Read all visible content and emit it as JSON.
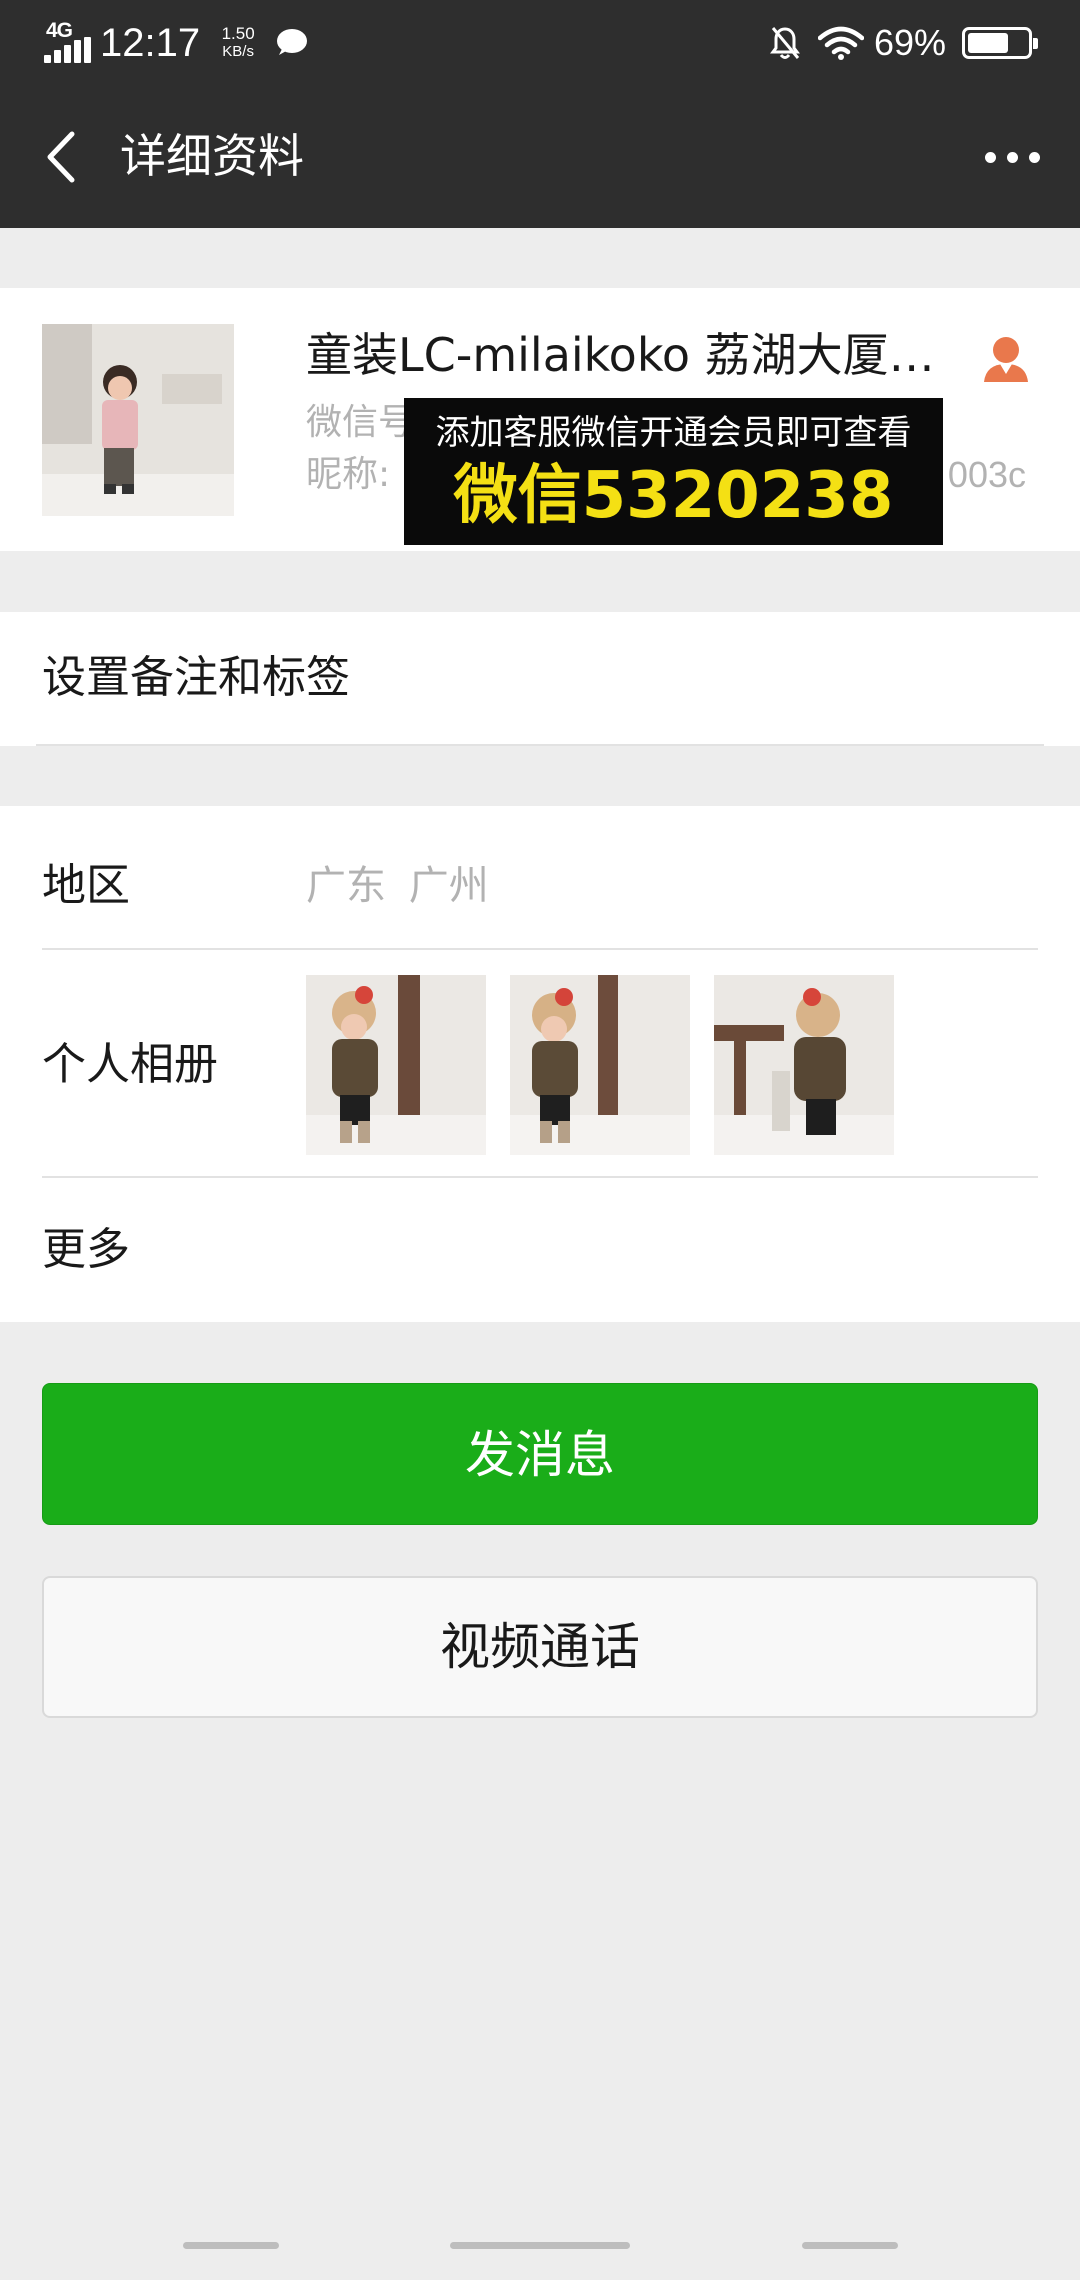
{
  "status_bar": {
    "network": "4G",
    "time": "12:17",
    "speed_value": "1.50",
    "speed_unit": "KB/s",
    "battery_percent": "69%",
    "battery_level": 0.69
  },
  "title_bar": {
    "title": "详细资料"
  },
  "profile": {
    "name": "童装LC-milaikoko 荔湖大厦…",
    "wechat_id_label": "微信号",
    "nickname_label": "昵称:",
    "nickname_tail": "003c",
    "promo_line1": "添加客服微信开通会员即可查看",
    "promo_line2": "微信5320238"
  },
  "remark": {
    "label": "设置备注和标签"
  },
  "info": {
    "region_label": "地区",
    "region_value": "广东  广州",
    "album_label": "个人相册",
    "more_label": "更多"
  },
  "actions": {
    "send_message": "发消息",
    "video_call": "视频通话"
  },
  "colors": {
    "header_bg": "#2e2e2e",
    "primary_green": "#1aad19",
    "page_bg": "#ededed",
    "promo_yellow": "#f4e014",
    "contact_icon": "#e9784c"
  },
  "icons": {
    "back": "chevron-left-icon",
    "more": "more-dots-icon",
    "contact_type": "person-icon",
    "status": [
      "signal-icon",
      "chat-bubble-icon",
      "bell-off-icon",
      "wifi-icon",
      "battery-icon"
    ]
  }
}
